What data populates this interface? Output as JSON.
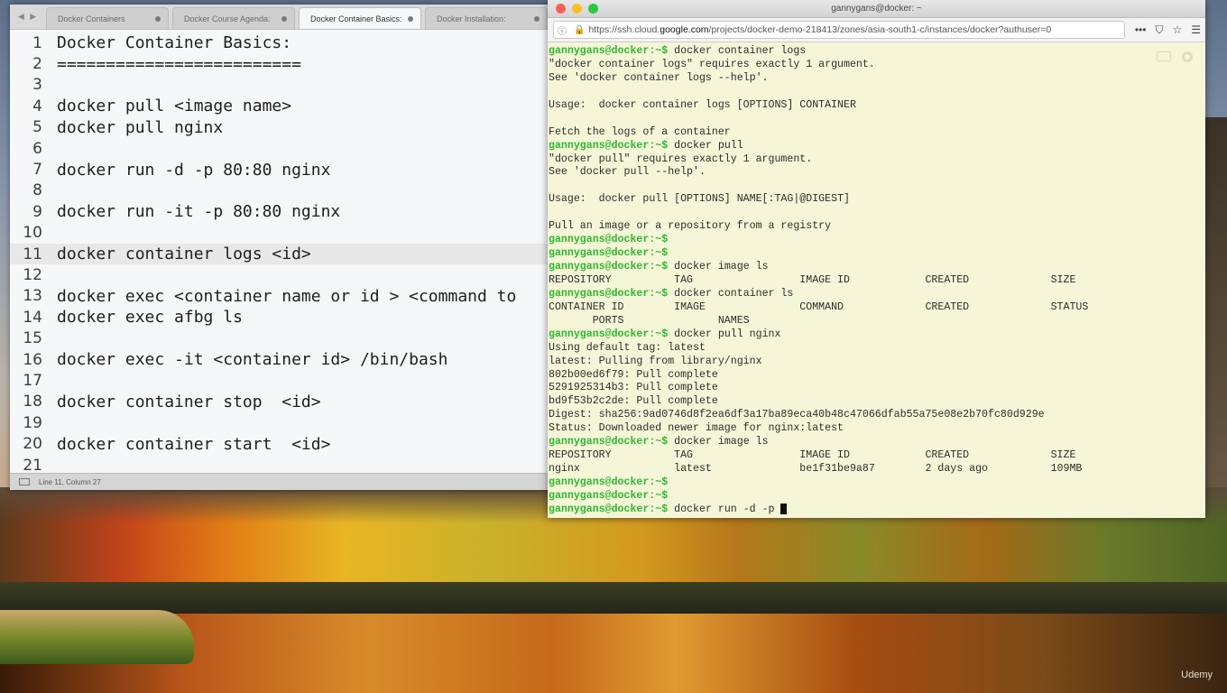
{
  "editor": {
    "nav": "◀ ▶",
    "tabs": [
      {
        "label": "Docker Containers",
        "active": false
      },
      {
        "label": "Docker Course Agenda:",
        "active": false
      },
      {
        "label": "Docker Container Basics:",
        "active": true
      },
      {
        "label": "Docker Installation:",
        "active": false
      }
    ],
    "lines": [
      "Docker Container Basics:",
      "=========================",
      "",
      "docker pull <image name>",
      "docker pull nginx",
      "",
      "docker run -d -p 80:80 nginx",
      "",
      "docker run -it -p 80:80 nginx",
      "",
      "docker container logs <id>",
      "",
      "docker exec <container name or id > <command to",
      "docker exec afbg ls",
      "",
      "docker exec -it <container id> /bin/bash",
      "",
      "docker container stop  <id>",
      "",
      "docker container start  <id>",
      ""
    ],
    "current_line": 11,
    "status": "Line 11, Column 27"
  },
  "browser": {
    "title": "gannygans@docker: ~",
    "url_prefix": "https://ssh.cloud.",
    "url_host": "google.com",
    "url_rest": "/projects/docker-demo-218413/zones/asia-south1-c/instances/docker?authuser=0",
    "menu_glyph": "•••"
  },
  "terminal": {
    "prompt": "gannygans@docker:~$",
    "lines": [
      {
        "prompt": true,
        "text": " docker container logs"
      },
      {
        "prompt": false,
        "text": "\"docker container logs\" requires exactly 1 argument."
      },
      {
        "prompt": false,
        "text": "See 'docker container logs --help'."
      },
      {
        "prompt": false,
        "text": ""
      },
      {
        "prompt": false,
        "text": "Usage:  docker container logs [OPTIONS] CONTAINER"
      },
      {
        "prompt": false,
        "text": ""
      },
      {
        "prompt": false,
        "text": "Fetch the logs of a container"
      },
      {
        "prompt": true,
        "text": " docker pull"
      },
      {
        "prompt": false,
        "text": "\"docker pull\" requires exactly 1 argument."
      },
      {
        "prompt": false,
        "text": "See 'docker pull --help'."
      },
      {
        "prompt": false,
        "text": ""
      },
      {
        "prompt": false,
        "text": "Usage:  docker pull [OPTIONS] NAME[:TAG|@DIGEST]"
      },
      {
        "prompt": false,
        "text": ""
      },
      {
        "prompt": false,
        "text": "Pull an image or a repository from a registry"
      },
      {
        "prompt": true,
        "text": ""
      },
      {
        "prompt": true,
        "text": ""
      },
      {
        "prompt": true,
        "text": " docker image ls"
      },
      {
        "prompt": false,
        "text": "REPOSITORY          TAG                 IMAGE ID            CREATED             SIZE"
      },
      {
        "prompt": true,
        "text": " docker container ls"
      },
      {
        "prompt": false,
        "text": "CONTAINER ID        IMAGE               COMMAND             CREATED             STATUS"
      },
      {
        "prompt": false,
        "text": "       PORTS               NAMES"
      },
      {
        "prompt": true,
        "text": " docker pull nginx"
      },
      {
        "prompt": false,
        "text": "Using default tag: latest"
      },
      {
        "prompt": false,
        "text": "latest: Pulling from library/nginx"
      },
      {
        "prompt": false,
        "text": "802b00ed6f79: Pull complete"
      },
      {
        "prompt": false,
        "text": "5291925314b3: Pull complete"
      },
      {
        "prompt": false,
        "text": "bd9f53b2c2de: Pull complete"
      },
      {
        "prompt": false,
        "text": "Digest: sha256:9ad0746d8f2ea6df3a17ba89eca40b48c47066dfab55a75e08e2b70fc80d929e"
      },
      {
        "prompt": false,
        "text": "Status: Downloaded newer image for nginx:latest"
      },
      {
        "prompt": true,
        "text": " docker image ls"
      },
      {
        "prompt": false,
        "text": "REPOSITORY          TAG                 IMAGE ID            CREATED             SIZE"
      },
      {
        "prompt": false,
        "text": "nginx               latest              be1f31be9a87        2 days ago          109MB"
      },
      {
        "prompt": true,
        "text": ""
      },
      {
        "prompt": true,
        "text": ""
      },
      {
        "prompt": true,
        "text": " docker run -d -p ",
        "cursor": true
      }
    ]
  },
  "watermark": "Udemy"
}
